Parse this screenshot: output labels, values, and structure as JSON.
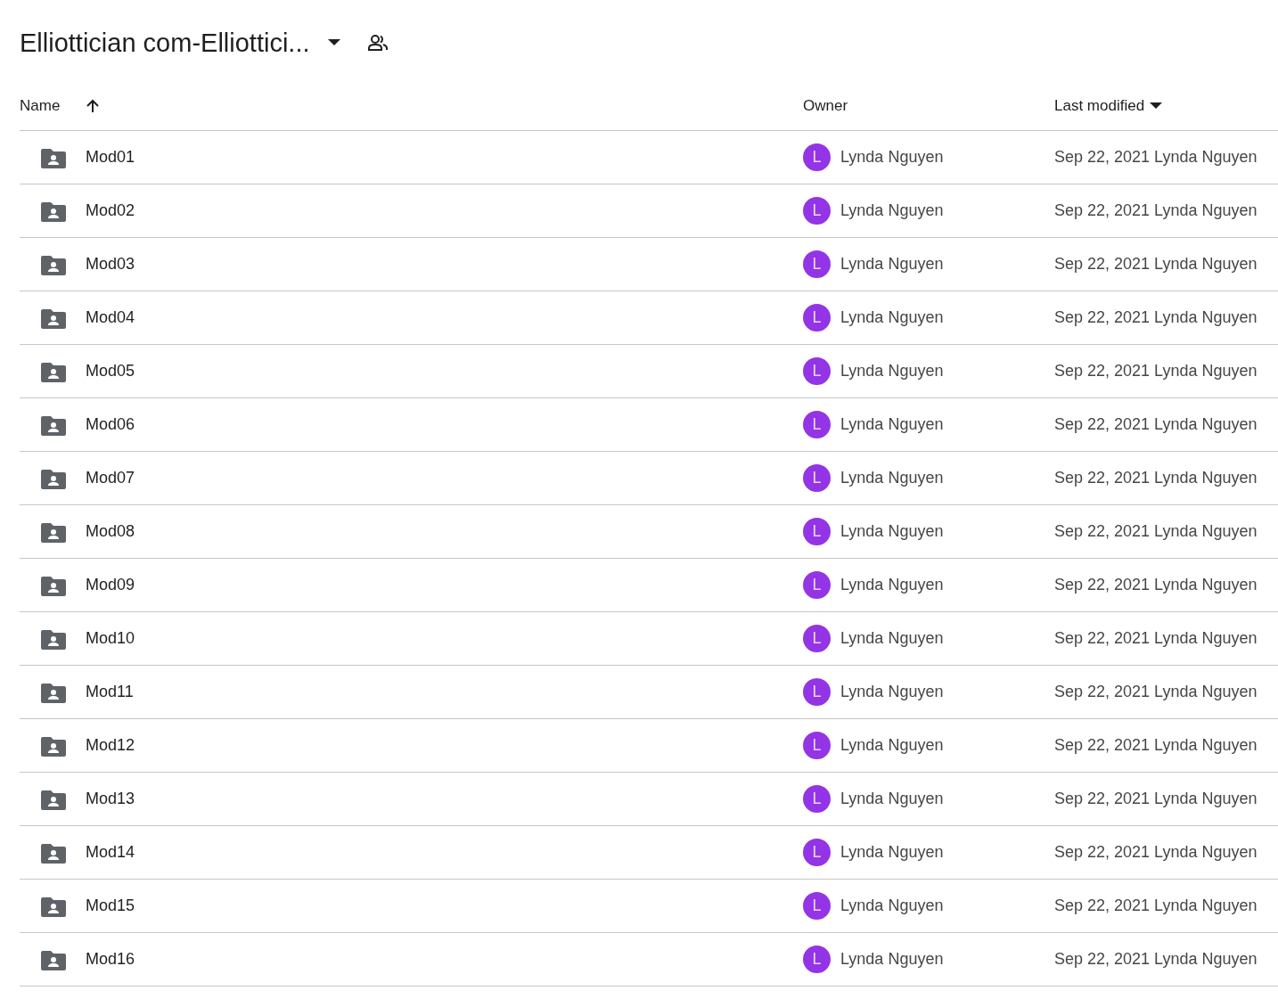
{
  "title": "Elliottician com-Elliottici...",
  "columns": [
    {
      "label": "Name",
      "kind": "sort-arrow"
    },
    {
      "label": "Owner",
      "kind": "plain"
    },
    {
      "label": "Last modified",
      "kind": "menu-caret"
    }
  ],
  "rows": [
    {
      "name": "Mod01",
      "owner": "Lynda Nguyen",
      "avatar": "L",
      "color": "#9334e6",
      "modified": "Sep 22, 2021 Lynda Nguyen"
    },
    {
      "name": "Mod02",
      "owner": "Lynda Nguyen",
      "avatar": "L",
      "color": "#9334e6",
      "modified": "Sep 22, 2021 Lynda Nguyen"
    },
    {
      "name": "Mod03",
      "owner": "Lynda Nguyen",
      "avatar": "L",
      "color": "#9334e6",
      "modified": "Sep 22, 2021 Lynda Nguyen"
    },
    {
      "name": "Mod04",
      "owner": "Lynda Nguyen",
      "avatar": "L",
      "color": "#9334e6",
      "modified": "Sep 22, 2021 Lynda Nguyen"
    },
    {
      "name": "Mod05",
      "owner": "Lynda Nguyen",
      "avatar": "L",
      "color": "#9334e6",
      "modified": "Sep 22, 2021 Lynda Nguyen"
    },
    {
      "name": "Mod06",
      "owner": "Lynda Nguyen",
      "avatar": "L",
      "color": "#9334e6",
      "modified": "Sep 22, 2021 Lynda Nguyen"
    },
    {
      "name": "Mod07",
      "owner": "Lynda Nguyen",
      "avatar": "L",
      "color": "#9334e6",
      "modified": "Sep 22, 2021 Lynda Nguyen"
    },
    {
      "name": "Mod08",
      "owner": "Lynda Nguyen",
      "avatar": "L",
      "color": "#9334e6",
      "modified": "Sep 22, 2021 Lynda Nguyen"
    },
    {
      "name": "Mod09",
      "owner": "Lynda Nguyen",
      "avatar": "L",
      "color": "#9334e6",
      "modified": "Sep 22, 2021 Lynda Nguyen"
    },
    {
      "name": "Mod10",
      "owner": "Lynda Nguyen",
      "avatar": "L",
      "color": "#9334e6",
      "modified": "Sep 22, 2021 Lynda Nguyen"
    },
    {
      "name": "Mod11",
      "owner": "Lynda Nguyen",
      "avatar": "L",
      "color": "#9334e6",
      "modified": "Sep 22, 2021 Lynda Nguyen"
    },
    {
      "name": "Mod12",
      "owner": "Lynda Nguyen",
      "avatar": "L",
      "color": "#9334e6",
      "modified": "Sep 22, 2021 Lynda Nguyen"
    },
    {
      "name": "Mod13",
      "owner": "Lynda Nguyen",
      "avatar": "L",
      "color": "#9334e6",
      "modified": "Sep 22, 2021 Lynda Nguyen"
    },
    {
      "name": "Mod14",
      "owner": "Lynda Nguyen",
      "avatar": "L",
      "color": "#9334e6",
      "modified": "Sep 22, 2021 Lynda Nguyen"
    },
    {
      "name": "Mod15",
      "owner": "Lynda Nguyen",
      "avatar": "L",
      "color": "#9334e6",
      "modified": "Sep 22, 2021 Lynda Nguyen"
    },
    {
      "name": "Mod16",
      "owner": "Lynda Nguyen",
      "avatar": "L",
      "color": "#9334e6",
      "modified": "Sep 22, 2021 Lynda Nguyen"
    }
  ]
}
